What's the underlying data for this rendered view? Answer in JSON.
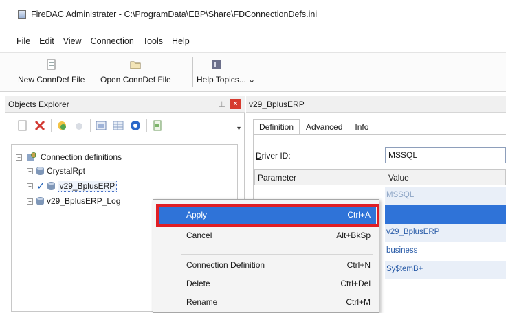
{
  "window": {
    "title": "FireDAC Administrater - C:\\ProgramData\\EBP\\Share\\FDConnectionDefs.ini"
  },
  "menu": [
    "File",
    "Edit",
    "View",
    "Connection",
    "Tools",
    "Help"
  ],
  "toolbar": {
    "new_conndef": "New ConnDef File",
    "open_conndef": "Open ConnDef File",
    "help_topics": "Help Topics..."
  },
  "objects_explorer": {
    "title": "Objects Explorer",
    "tree": {
      "root": "Connection definitions",
      "items": [
        "CrystalRpt",
        "v29_BplusERP",
        "v29_BplusERP_Log"
      ]
    }
  },
  "editor": {
    "title": "v29_BplusERP",
    "tabs": [
      "Definition",
      "Advanced",
      "Info"
    ],
    "driver_label": "Driver ID:",
    "driver_value": "MSSQL",
    "grid_headers": [
      "Parameter",
      "Value"
    ],
    "grid_values": [
      "MSSQL",
      "",
      "v29_BplusERP",
      "business",
      "Sy$temB+"
    ]
  },
  "context_menu": {
    "items": [
      {
        "label": "Apply",
        "shortcut": "Ctrl+A"
      },
      {
        "label": "Cancel",
        "shortcut": "Alt+BkSp"
      },
      {
        "label": "Connection Definition",
        "shortcut": "Ctrl+N"
      },
      {
        "label": "Delete",
        "shortcut": "Ctrl+Del"
      },
      {
        "label": "Rename",
        "shortcut": "Ctrl+M"
      }
    ]
  },
  "colors": {
    "highlight": "#2f73d8",
    "annotation": "#e01e24"
  }
}
